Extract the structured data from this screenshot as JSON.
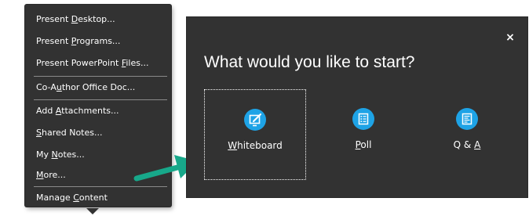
{
  "menu": {
    "items": [
      {
        "pre": "Present ",
        "key": "D",
        "post": "esktop..."
      },
      {
        "pre": "Present ",
        "key": "P",
        "post": "rograms..."
      },
      {
        "pre": "Present PowerPoint ",
        "key": "F",
        "post": "iles..."
      },
      {
        "pre": "Co-A",
        "key": "u",
        "post": "thor Office Doc..."
      },
      {
        "pre": "Add ",
        "key": "A",
        "post": "ttachments..."
      },
      {
        "pre": "",
        "key": "S",
        "post": "hared Notes..."
      },
      {
        "pre": "My ",
        "key": "N",
        "post": "otes..."
      },
      {
        "pre": "",
        "key": "M",
        "post": "ore..."
      },
      {
        "pre": "Manage ",
        "key": "C",
        "post": "ontent"
      }
    ]
  },
  "dialog": {
    "title": "What would you like to start?",
    "close_glyph": "×",
    "options": [
      {
        "pre": "",
        "key": "W",
        "post": "hiteboard",
        "icon": "whiteboard-icon",
        "selected": true
      },
      {
        "pre": "",
        "key": "P",
        "post": "oll",
        "icon": "poll-icon",
        "selected": false
      },
      {
        "pre": "Q & ",
        "key": "A",
        "post": "",
        "icon": "qa-icon",
        "selected": false
      }
    ]
  },
  "colors": {
    "panel": "#323232",
    "accent": "#1ea3e6",
    "arrow": "#17a88a"
  }
}
